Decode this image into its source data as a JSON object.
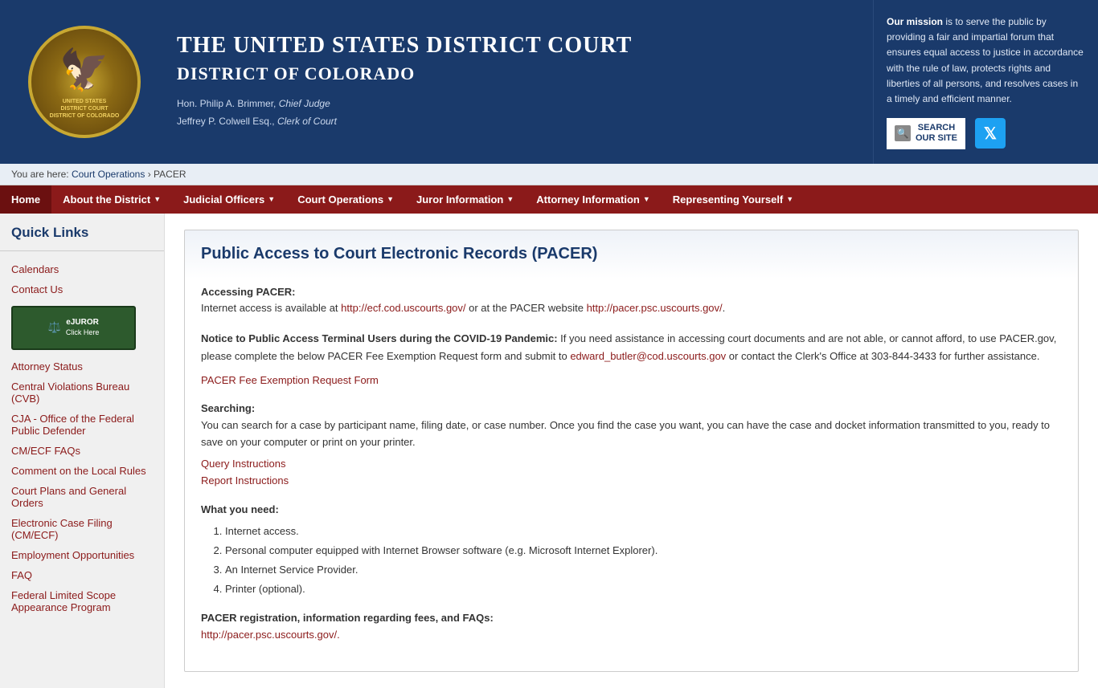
{
  "header": {
    "court_name_line1": "The United States District Court",
    "court_name_line2": "District of Colorado",
    "chief_judge": "Hon. Philip A. Brimmer,",
    "chief_judge_title": "Chief Judge",
    "clerk": "Jeffrey P. Colwell Esq.,",
    "clerk_title": "Clerk of Court",
    "mission_text_strong": "Our mission",
    "mission_text": " is to serve the public by providing a fair and impartial forum that ensures equal access to justice in accordance with the rule of law, protects rights and liberties of all persons, and resolves cases in a timely and efficient manner.",
    "search_label_line1": "Search",
    "search_label_line2": "Our Site"
  },
  "breadcrumb": {
    "prefix": "You are here:",
    "link": "Court Operations",
    "separator": "›",
    "current": "PACER"
  },
  "nav": {
    "items": [
      {
        "label": "Home",
        "has_arrow": false,
        "home": true
      },
      {
        "label": "About the District",
        "has_arrow": true,
        "home": false
      },
      {
        "label": "Judicial Officers",
        "has_arrow": true,
        "home": false
      },
      {
        "label": "Court Operations",
        "has_arrow": true,
        "home": false
      },
      {
        "label": "Juror Information",
        "has_arrow": true,
        "home": false
      },
      {
        "label": "Attorney Information",
        "has_arrow": true,
        "home": false
      },
      {
        "label": "Representing Yourself",
        "has_arrow": true,
        "home": false
      }
    ]
  },
  "sidebar": {
    "title": "Quick Links",
    "ejuror_label": "eJUROR\nClick Here",
    "links": [
      "Calendars",
      "Contact Us",
      "Attorney Status",
      "Central Violations Bureau (CVB)",
      "CJA - Office of the Federal Public Defender",
      "CM/ECF FAQs",
      "Comment on the Local Rules",
      "Court Plans and General Orders",
      "Electronic Case Filing (CM/ECF)",
      "Employment Opportunities",
      "FAQ",
      "Federal Limited Scope Appearance Program"
    ]
  },
  "main": {
    "page_title": "Public Access to Court Electronic Records (PACER)",
    "accessing_label": "Accessing PACER:",
    "accessing_text": "Internet access is available at ",
    "accessing_link1": "http://ecf.cod.uscourts.gov/",
    "accessing_text2": " or at the PACER website ",
    "accessing_link2": "http://pacer.psc.uscourts.gov/",
    "accessing_text3": ".",
    "notice_bold": "Notice to Public Access Terminal Users during the COVID-19 Pandemic:",
    "notice_text": " If you need assistance in accessing court documents and are not able, or cannot afford, to use PACER.gov, please complete the below PACER Fee Exemption Request form and submit to ",
    "notice_email": "edward_butler@cod.uscourts.gov",
    "notice_text2": " or contact the Clerk's Office at 303-844-3433 for further assistance.",
    "fee_exemption_link": "PACER Fee Exemption Request Form",
    "searching_label": "Searching:",
    "searching_text": "You can search for a case by participant name, filing date, or case number. Once you find the case you want, you can have the case and docket information transmitted to you, ready to save on your computer or print on your printer.",
    "query_link": "Query Instructions",
    "report_link": "Report Instructions",
    "what_you_need_label": "What you need:",
    "needs": [
      "Internet access.",
      "Personal computer equipped with Internet Browser software (e.g. Microsoft Internet Explorer).",
      "An Internet Service Provider.",
      "Printer (optional)."
    ],
    "registration_label": "PACER registration, information regarding fees, and FAQs:",
    "registration_link": "http://pacer.psc.uscourts.gov/."
  }
}
